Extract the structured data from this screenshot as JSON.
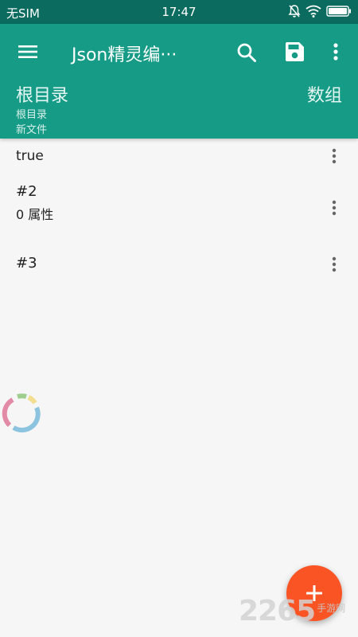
{
  "status_bar": {
    "carrier": "无SIM",
    "time": "17:47",
    "icons": [
      "bell-off-icon",
      "wifi-icon",
      "battery-icon"
    ]
  },
  "toolbar": {
    "title": "Json精灵编···",
    "menu_icon": "menu-icon",
    "search_icon": "search-icon",
    "save_icon": "save-icon",
    "more_icon": "more-vert-icon"
  },
  "breadcrumb": {
    "title": "根目录",
    "type": "数组",
    "path": "根目录",
    "file": "新文件"
  },
  "items": [
    {
      "key": "true",
      "sub": ""
    },
    {
      "key": "#2",
      "sub": "0 属性"
    },
    {
      "key": "#3",
      "sub": ""
    }
  ],
  "fab": {
    "icon": "plus-icon"
  },
  "watermark": {
    "number": "2265",
    "site": "手游网"
  },
  "colors": {
    "status_bar": "#0b6b5e",
    "app_bar": "#169b86",
    "background": "#f6f6f6",
    "fab": "#fa5424"
  }
}
